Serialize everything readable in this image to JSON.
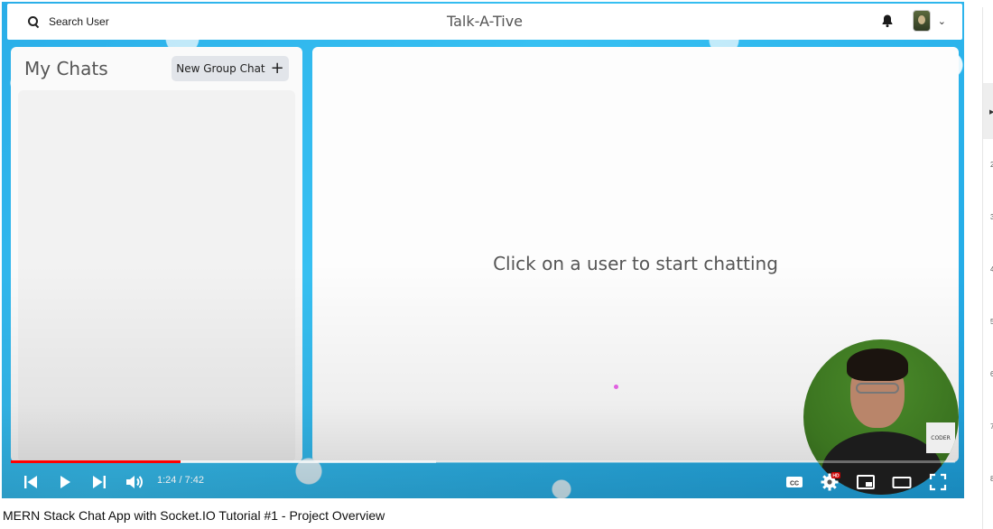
{
  "app": {
    "search_label": "Search User",
    "brand": "Talk-A-Tive"
  },
  "chats": {
    "title": "My Chats",
    "new_group_label": "New Group Chat",
    "new_group_icon": "plus-icon"
  },
  "chatbox": {
    "empty_message": "Click on a user to start chatting"
  },
  "facecam": {
    "badge_text": "CODER"
  },
  "player": {
    "time": "1:24 / 7:42",
    "played_fraction": 0.18,
    "buffered_fraction": 0.45,
    "accent": "#ff0000",
    "hd_badge": "HD"
  },
  "playlist": {
    "numbers": [
      "2",
      "3",
      "4",
      "5",
      "6",
      "7",
      "8"
    ]
  },
  "video": {
    "title": "MERN Stack Chat App with Socket.IO Tutorial #1 - Project Overview"
  }
}
